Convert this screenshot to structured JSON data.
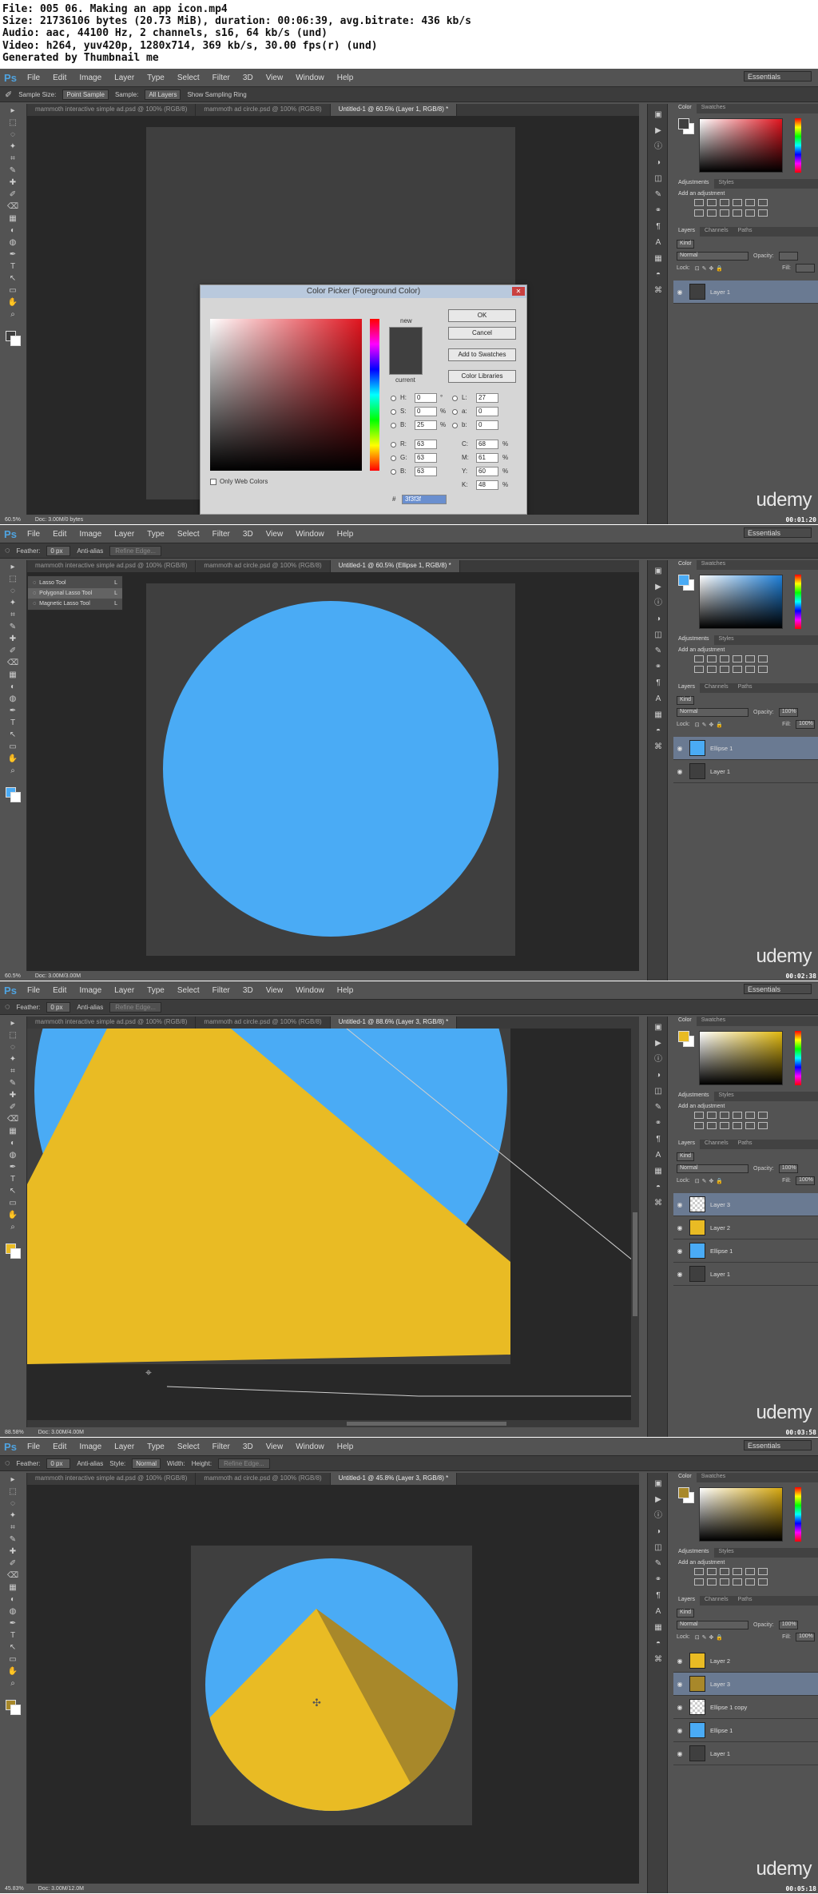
{
  "header": {
    "lines": [
      "File: 005 06. Making an app icon.mp4",
      "Size: 21736106 bytes (20.73 MiB), duration: 00:06:39, avg.bitrate: 436 kb/s",
      "Audio: aac, 44100 Hz, 2 channels, s16, 64 kb/s (und)",
      "Video: h264, yuv420p, 1280x714, 369 kb/s, 30.00 fps(r) (und)",
      "Generated by Thumbnail me"
    ]
  },
  "app": {
    "logo": "Ps",
    "menu": [
      "File",
      "Edit",
      "Image",
      "Layer",
      "Type",
      "Select",
      "Filter",
      "3D",
      "View",
      "Window",
      "Help"
    ],
    "workspace": "Essentials",
    "brand": "udemy"
  },
  "frames": [
    {
      "timestamp": "00:01:20",
      "options": {
        "items": [
          "Sample Size:",
          "Point Sample",
          "Sample:",
          "All Layers",
          "Show Sampling Ring"
        ]
      },
      "tabs": [
        "mammoth interactive simple ad.psd @ 100% (RGB/8)",
        "mammoth ad circle.psd @ 100% (RGB/8)",
        "Untitled-1 @ 60.5% (Layer 1, RGB/8) *"
      ],
      "status": {
        "zoom": "60.5%",
        "doc": "Doc: 3.00M/0 bytes"
      },
      "fg": "#3f3f3f",
      "panel_tabs": {
        "color": [
          "Color",
          "Swatches"
        ],
        "adj": [
          "Adjustments",
          "Styles"
        ],
        "layers": [
          "Layers",
          "Channels",
          "Paths"
        ]
      },
      "adjust_title": "Add an adjustment",
      "layer_ctl": {
        "kind": "Kind",
        "mode": "Normal",
        "opacity_label": "Opacity:",
        "opacity": "",
        "lock": "Lock:",
        "fill_label": "Fill:",
        "fill": ""
      },
      "layers": [
        {
          "name": "Layer 1",
          "selected": true,
          "thumb": "#3f3f3f"
        }
      ],
      "dialog": {
        "title": "Color Picker (Foreground Color)",
        "buttons": [
          "OK",
          "Cancel",
          "Add to Swatches",
          "Color Libraries"
        ],
        "new_label": "new",
        "current_label": "current",
        "only_web": "Only Web Colors",
        "fields": {
          "H": "0",
          "S": "0",
          "B": "25",
          "R": "63",
          "G": "63",
          "Bb": "63",
          "L": "27",
          "a": "0",
          "b": "0",
          "C": "68",
          "M": "61",
          "Y": "60",
          "K": "48"
        },
        "units": {
          "deg": "°",
          "pct": "%"
        },
        "hex": "3f3f3f",
        "hash": "#"
      }
    },
    {
      "timestamp": "00:02:38",
      "options": {
        "items": [
          "Feather:",
          "0 px",
          "Anti-alias",
          "Refine Edge..."
        ]
      },
      "tabs": [
        "mammoth interactive simple ad.psd @ 100% (RGB/8)",
        "mammoth ad circle.psd @ 100% (RGB/8)",
        "Untitled-1 @ 60.5% (Ellipse 1, RGB/8) *"
      ],
      "status": {
        "zoom": "60.5%",
        "doc": "Doc: 3.00M/3.00M"
      },
      "fg": "#4aabf5",
      "lasso_menu": [
        {
          "label": "Lasso Tool",
          "key": "L"
        },
        {
          "label": "Polygonal Lasso Tool",
          "key": "L"
        },
        {
          "label": "Magnetic Lasso Tool",
          "key": "L"
        }
      ],
      "panel_tabs": {
        "color": [
          "Color",
          "Swatches"
        ],
        "adj": [
          "Adjustments",
          "Styles"
        ],
        "layers": [
          "Layers",
          "Channels",
          "Paths"
        ]
      },
      "adjust_title": "Add an adjustment",
      "layer_ctl": {
        "kind": "Kind",
        "mode": "Normal",
        "opacity_label": "Opacity:",
        "opacity": "100%",
        "lock": "Lock:",
        "fill_label": "Fill:",
        "fill": "100%"
      },
      "layers": [
        {
          "name": "Ellipse 1",
          "selected": true,
          "thumb": "#4aabf5"
        },
        {
          "name": "Layer 1",
          "selected": false,
          "thumb": "#3f3f3f"
        }
      ]
    },
    {
      "timestamp": "00:03:58",
      "options": {
        "items": [
          "Feather:",
          "0 px",
          "Anti-alias",
          "Refine Edge..."
        ]
      },
      "tabs": [
        "mammoth interactive simple ad.psd @ 100% (RGB/8)",
        "mammoth ad circle.psd @ 100% (RGB/8)",
        "Untitled-1 @ 88.6% (Layer 3, RGB/8) *"
      ],
      "status": {
        "zoom": "88.58%",
        "doc": "Doc: 3.00M/4.00M"
      },
      "fg": "#e9bb24",
      "panel_tabs": {
        "color": [
          "Color",
          "Swatches"
        ],
        "adj": [
          "Adjustments",
          "Styles"
        ],
        "layers": [
          "Layers",
          "Channels",
          "Paths"
        ]
      },
      "adjust_title": "Add an adjustment",
      "layer_ctl": {
        "kind": "Kind",
        "mode": "Normal",
        "opacity_label": "Opacity:",
        "opacity": "100%",
        "lock": "Lock:",
        "fill_label": "Fill:",
        "fill": "100%"
      },
      "layers": [
        {
          "name": "Layer 3",
          "selected": true,
          "thumb": "transparent"
        },
        {
          "name": "Layer 2",
          "selected": false,
          "thumb": "#e9bb24"
        },
        {
          "name": "Ellipse 1",
          "selected": false,
          "thumb": "#4aabf5"
        },
        {
          "name": "Layer 1",
          "selected": false,
          "thumb": "#3f3f3f"
        }
      ]
    },
    {
      "timestamp": "00:05:18",
      "options": {
        "items": [
          "Feather:",
          "0 px",
          "Anti-alias",
          "Style:",
          "Normal",
          "Width:",
          "Height:",
          "Refine Edge..."
        ]
      },
      "tabs": [
        "mammoth interactive simple ad.psd @ 100% (RGB/8)",
        "mammoth ad circle.psd @ 100% (RGB/8)",
        "Untitled-1 @ 45.8% (Layer 3, RGB/8) *"
      ],
      "status": {
        "zoom": "45.83%",
        "doc": "Doc: 3.00M/12.0M"
      },
      "fg": "#a8882a",
      "panel_tabs": {
        "color": [
          "Color",
          "Swatches"
        ],
        "adj": [
          "Adjustments",
          "Styles"
        ],
        "layers": [
          "Layers",
          "Channels",
          "Paths"
        ]
      },
      "adjust_title": "Add an adjustment",
      "layer_ctl": {
        "kind": "Kind",
        "mode": "Normal",
        "opacity_label": "Opacity:",
        "opacity": "100%",
        "lock": "Lock:",
        "fill_label": "Fill:",
        "fill": "100%"
      },
      "layers": [
        {
          "name": "Layer 2",
          "selected": false,
          "thumb": "#e9bb24"
        },
        {
          "name": "Layer 3",
          "selected": true,
          "thumb": "#a8882a"
        },
        {
          "name": "Ellipse 1 copy",
          "selected": false,
          "thumb": "transparent"
        },
        {
          "name": "Ellipse 1",
          "selected": false,
          "thumb": "#4aabf5"
        },
        {
          "name": "Layer 1",
          "selected": false,
          "thumb": "#3f3f3f"
        }
      ]
    }
  ],
  "colors": {
    "blue": "#4aabf5",
    "yellow": "#e9bb24",
    "gray": "#3f3f3f",
    "shade": "#a8882a"
  }
}
